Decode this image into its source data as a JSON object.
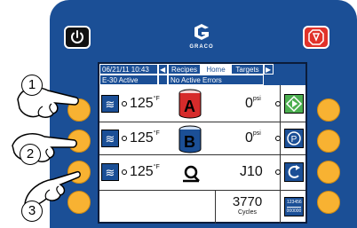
{
  "top": {
    "power_icon": "power-icon",
    "stop_icon": "stop-icon",
    "logo_text": "GRACO"
  },
  "status_bar": {
    "datetime": "06/21/11 10:43",
    "tabs": [
      "Recipes",
      "Home",
      "Targets"
    ],
    "active_tab": "Home",
    "recipe_status": "E-30 Active",
    "error_status": "No Active Errors"
  },
  "rows": [
    {
      "heater_icon": "heater-icon",
      "temperature": "125",
      "temp_unit": "°F",
      "component": "A",
      "value": "0",
      "value_unit": "psi",
      "action_icon": "start-icon"
    },
    {
      "heater_icon": "heater-icon",
      "temperature": "125",
      "temp_unit": "°F",
      "component": "B",
      "value": "0",
      "value_unit": "psi",
      "action_icon": "park-icon"
    },
    {
      "heater_icon": "heater-icon",
      "temperature": "125",
      "temp_unit": "°F",
      "component": "hose",
      "value": "J10",
      "value_unit": "",
      "action_icon": "recirculation-icon"
    },
    {
      "cycles_value": "3770",
      "cycles_label": "Cycles",
      "counter_icon": "reset-counter-icon",
      "counter_text": "123456"
    }
  ],
  "callouts": [
    "1",
    "2",
    "3"
  ],
  "colors": {
    "panel": "#1b4f96",
    "buttons": "#f8b232",
    "stop": "#e0322a",
    "start": "#4caf50",
    "component_a": "#d62b2b"
  }
}
